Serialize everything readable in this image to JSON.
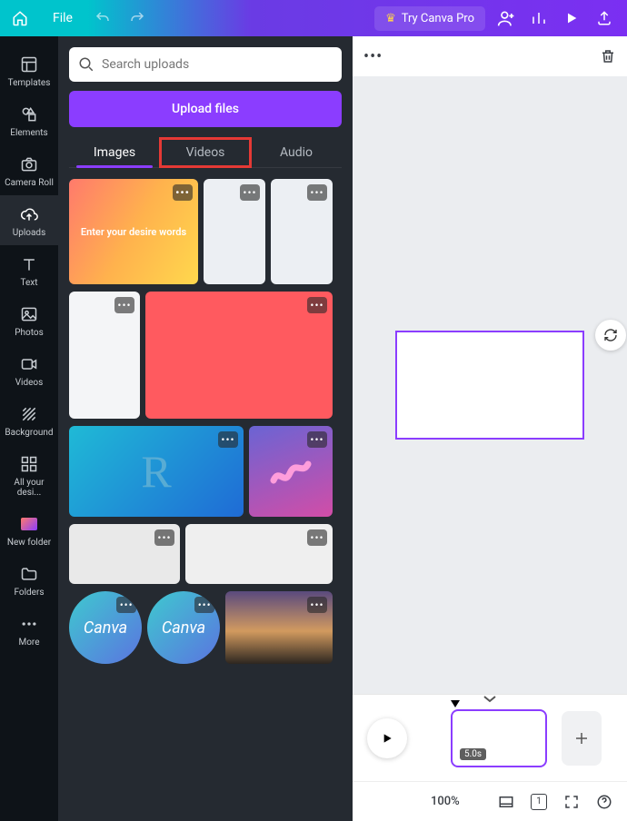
{
  "topbar": {
    "file_label": "File",
    "try_pro_label": "Try Canva Pro"
  },
  "rail": {
    "items": [
      {
        "label": "Templates"
      },
      {
        "label": "Elements"
      },
      {
        "label": "Camera Roll"
      },
      {
        "label": "Uploads"
      },
      {
        "label": "Text"
      },
      {
        "label": "Photos"
      },
      {
        "label": "Videos"
      },
      {
        "label": "Background"
      },
      {
        "label": "All your desi..."
      },
      {
        "label": "New folder"
      },
      {
        "label": "Folders"
      },
      {
        "label": "More"
      }
    ]
  },
  "panel": {
    "search_placeholder": "Search uploads",
    "upload_label": "Upload files",
    "tabs": {
      "images": "Images",
      "videos": "Videos",
      "audio": "Audio"
    },
    "thumb_text_1": "Enter your desire words",
    "canva_logo_text": "Canva"
  },
  "canvas": {
    "clip_duration": "5.0s",
    "zoom": "100%",
    "page_indicator": "1"
  }
}
